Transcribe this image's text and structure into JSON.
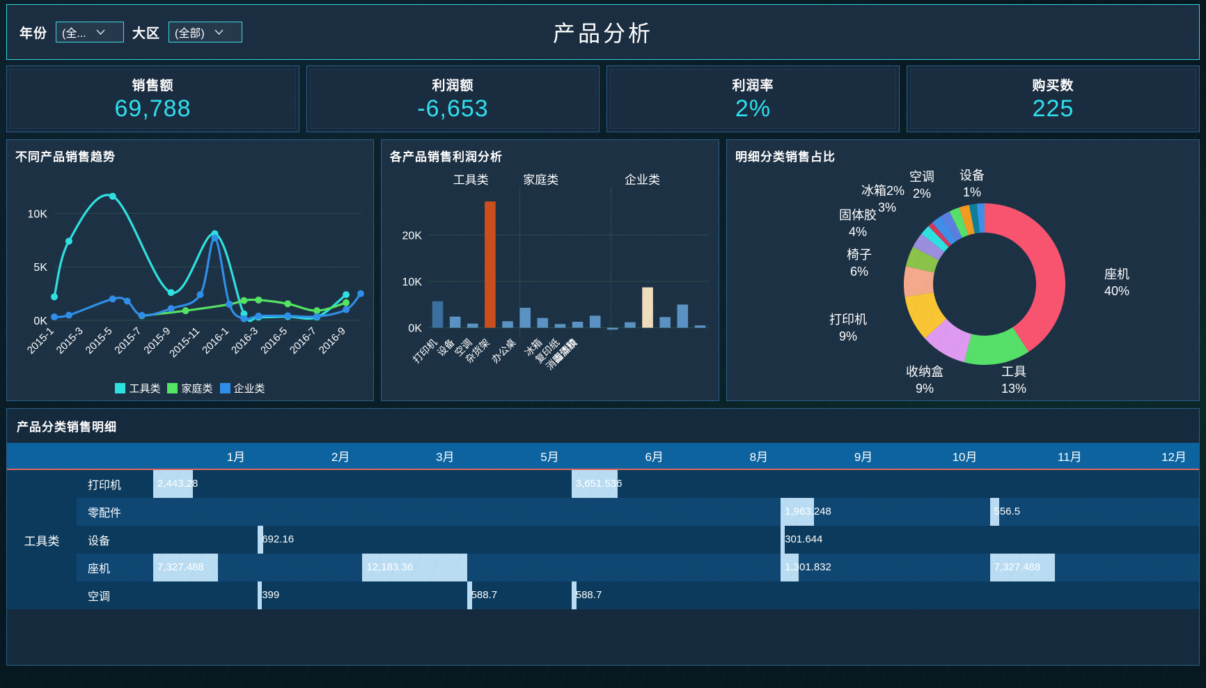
{
  "header": {
    "title": "产品分析",
    "filters": [
      {
        "label": "年份",
        "value": "(全...",
        "icon": "chevron-down-icon"
      },
      {
        "label": "大区",
        "value": "(全部)",
        "icon": "chevron-down-icon"
      }
    ]
  },
  "kpis": [
    {
      "title": "销售额",
      "value": "69,788"
    },
    {
      "title": "利润额",
      "value": "-6,653"
    },
    {
      "title": "利润率",
      "value": "2%"
    },
    {
      "title": "购买数",
      "value": "225"
    }
  ],
  "panels": {
    "line_title": "不同产品销售趋势",
    "bar_title": "各产品销售利润分析",
    "pie_title": "明细分类销售占比",
    "table_title": "产品分类销售明细"
  },
  "chart_data": [
    {
      "type": "line",
      "title": "不同产品销售趋势",
      "xlabel": "",
      "ylabel": "",
      "ylim": [
        0,
        12500
      ],
      "yticks": [
        0,
        5000,
        10000
      ],
      "ytick_labels": [
        "0K",
        "5K",
        "10K"
      ],
      "grid": true,
      "legend_position": "bottom",
      "x": [
        "2015-1",
        "2015-2",
        "2015-3",
        "2015-4",
        "2015-5",
        "2015-6",
        "2015-7",
        "2015-8",
        "2015-9",
        "2015-10",
        "2015-11",
        "2015-12",
        "2016-1",
        "2016-2",
        "2016-3",
        "2016-4",
        "2016-5",
        "2016-6",
        "2016-7",
        "2016-8",
        "2016-9",
        "2016-10"
      ],
      "xtick_labels": [
        "2015-1",
        "2015-3",
        "2015-5",
        "2015-7",
        "2015-9",
        "2015-11",
        "2016-1",
        "2016-3",
        "2016-5",
        "2016-7",
        "2016-9"
      ],
      "series": [
        {
          "name": "工具类",
          "color": "#2fe0e0",
          "values": [
            2200,
            7400,
            null,
            null,
            11600,
            null,
            null,
            null,
            2600,
            null,
            null,
            8100,
            null,
            600,
            300,
            null,
            350,
            null,
            300,
            null,
            2400,
            null
          ]
        },
        {
          "name": "家庭类",
          "color": "#55e362",
          "values": [
            null,
            null,
            null,
            null,
            null,
            null,
            430,
            null,
            null,
            900,
            null,
            null,
            1500,
            1850,
            1900,
            null,
            1550,
            null,
            900,
            null,
            1650,
            null
          ]
        },
        {
          "name": "企业类",
          "color": "#2f8fe8",
          "values": [
            320,
            480,
            null,
            null,
            2000,
            1800,
            460,
            null,
            1100,
            null,
            2400,
            7700,
            1500,
            150,
            400,
            null,
            420,
            null,
            350,
            null,
            1000,
            2500
          ]
        }
      ]
    },
    {
      "type": "bar",
      "title": "各产品销售利润分析",
      "ylim": [
        -2000,
        28000
      ],
      "yticks": [
        0,
        10000,
        20000
      ],
      "ytick_labels": [
        "0K",
        "10K",
        "20K"
      ],
      "grid": true,
      "group_labels": [
        "工具类",
        "家庭类",
        "企业类"
      ],
      "categories": [
        "打印机",
        "设备",
        "空调",
        "杂货架",
        "办公桌",
        "冰箱",
        "复印纸",
        "固体胶",
        "消毒酒精"
      ],
      "bars": [
        {
          "label": "打印机",
          "value": 5700,
          "color": "#3a6f9e"
        },
        {
          "label": "设备",
          "value": 2400,
          "color": "#5b92c4"
        },
        {
          "label": "空调",
          "value": 900,
          "color": "#5b92c4"
        },
        {
          "label": "杂货架",
          "value": 27200,
          "color": "#cc4e1c"
        },
        {
          "label": "办公桌",
          "value": 1400,
          "color": "#5b92c4"
        },
        {
          "label": "冰箱",
          "value": 4300,
          "color": "#5b92c4"
        },
        {
          "label": "复印纸",
          "value": 2100,
          "color": "#5b92c4"
        },
        {
          "label": "固体胶",
          "value": 800,
          "color": "#5b92c4"
        },
        {
          "label": "消毒酒精",
          "value": 1300,
          "color": "#5b92c4"
        },
        {
          "label": "b10",
          "value": 2600,
          "color": "#5b92c4"
        },
        {
          "label": "b11",
          "value": -400,
          "color": "#5b92c4"
        },
        {
          "label": "b12",
          "value": 1200,
          "color": "#5b92c4"
        },
        {
          "label": "b13",
          "value": 8700,
          "color": "#efddbc"
        },
        {
          "label": "b14",
          "value": 2300,
          "color": "#5b92c4"
        },
        {
          "label": "b15",
          "value": 5000,
          "color": "#5b92c4"
        },
        {
          "label": "b16",
          "value": 500,
          "color": "#5b92c4"
        }
      ]
    },
    {
      "type": "pie",
      "title": "明细分类销售占比",
      "donut": true,
      "labels": [
        "座机",
        "工具",
        "收纳盒",
        "打印机",
        "椅子",
        "固体胶",
        "冰箱",
        "空调",
        "设备"
      ],
      "values": [
        40,
        13,
        9,
        9,
        6,
        4,
        3,
        2,
        1
      ],
      "percent_labels": [
        "40%",
        "13%",
        "9%",
        "9%",
        "6%",
        "4%",
        "3%",
        "2%",
        "1%"
      ],
      "colors": [
        "#f9546f",
        "#56e06a",
        "#dd9af0",
        "#fac533",
        "#f4a98a",
        "#8ac24a",
        "#9b8ede",
        "#2fe0e0",
        "#d6375b"
      ],
      "extra_slice_colors": [
        "#3f8fe8",
        "#5b7fe0",
        "#56e06a",
        "#f29a22",
        "#0e7f9b"
      ]
    }
  ],
  "table": {
    "title": "产品分类销售明细",
    "columns": [
      "",
      "",
      "1月",
      "2月",
      "3月",
      "5月",
      "6月",
      "8月",
      "9月",
      "10月",
      "11月",
      "12月"
    ],
    "rows": [
      {
        "category": "工具类",
        "subcategory": "打印机",
        "shade": "A",
        "cells": [
          {
            "value": "2,443.28",
            "barpct": 38
          },
          {
            "value": "",
            "barpct": 0
          },
          {
            "value": "",
            "barpct": 0
          },
          {
            "value": "",
            "barpct": 0
          },
          {
            "value": "3,651.536",
            "barpct": 44
          },
          {
            "value": "",
            "barpct": 0
          },
          {
            "value": "",
            "barpct": 0
          },
          {
            "value": "",
            "barpct": 0
          },
          {
            "value": "",
            "barpct": 0
          },
          {
            "value": "",
            "barpct": 0
          }
        ]
      },
      {
        "category": "",
        "subcategory": "零配件",
        "shade": "B",
        "cells": [
          {
            "value": "",
            "barpct": 0
          },
          {
            "value": "",
            "barpct": 0
          },
          {
            "value": "",
            "barpct": 0
          },
          {
            "value": "",
            "barpct": 0
          },
          {
            "value": "",
            "barpct": 0
          },
          {
            "value": "",
            "barpct": 0
          },
          {
            "value": "1,963.248",
            "barpct": 32
          },
          {
            "value": "",
            "barpct": 0
          },
          {
            "value": "556.5",
            "barpct": 9
          },
          {
            "value": "",
            "barpct": 0
          }
        ]
      },
      {
        "category": "",
        "subcategory": "设备",
        "shade": "A",
        "cells": [
          {
            "value": "",
            "barpct": 0
          },
          {
            "value": "692.16",
            "barpct": 5
          },
          {
            "value": "",
            "barpct": 0
          },
          {
            "value": "",
            "barpct": 0
          },
          {
            "value": "",
            "barpct": 0
          },
          {
            "value": "",
            "barpct": 0
          },
          {
            "value": "301.644",
            "barpct": 4
          },
          {
            "value": "",
            "barpct": 0
          },
          {
            "value": "",
            "barpct": 0
          },
          {
            "value": "",
            "barpct": 0
          }
        ]
      },
      {
        "category": "",
        "subcategory": "座机",
        "shade": "B",
        "cells": [
          {
            "value": "7,327.488",
            "barpct": 62
          },
          {
            "value": "",
            "barpct": 0
          },
          {
            "value": "12,183.36",
            "barpct": 100
          },
          {
            "value": "",
            "barpct": 0
          },
          {
            "value": "",
            "barpct": 0
          },
          {
            "value": "",
            "barpct": 0
          },
          {
            "value": "1,301.832",
            "barpct": 17
          },
          {
            "value": "",
            "barpct": 0
          },
          {
            "value": "7,327.488",
            "barpct": 62
          },
          {
            "value": "",
            "barpct": 0
          }
        ]
      },
      {
        "category": "",
        "subcategory": "空调",
        "shade": "A",
        "cells": [
          {
            "value": "",
            "barpct": 0
          },
          {
            "value": "399",
            "barpct": 4
          },
          {
            "value": "",
            "barpct": 0
          },
          {
            "value": "588.7",
            "barpct": 5
          },
          {
            "value": "588.7",
            "barpct": 5
          },
          {
            "value": "",
            "barpct": 0
          },
          {
            "value": "",
            "barpct": 0
          },
          {
            "value": "",
            "barpct": 0
          },
          {
            "value": "",
            "barpct": 0
          },
          {
            "value": "",
            "barpct": 0
          }
        ]
      }
    ]
  }
}
